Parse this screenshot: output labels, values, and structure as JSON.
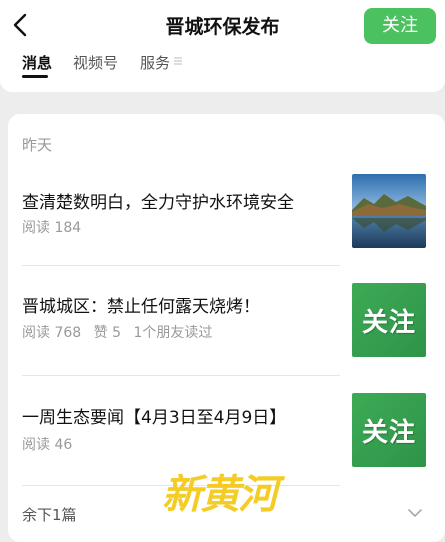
{
  "header": {
    "title": "晋城环保发布",
    "follow_label": "关注"
  },
  "tabs": [
    {
      "label": "消息",
      "active": true
    },
    {
      "label": "视频号",
      "active": false
    },
    {
      "label": "服务",
      "active": false
    }
  ],
  "feed": {
    "date_label": "昨天",
    "articles": [
      {
        "title": "查清楚数明白，全力守护水环境安全",
        "reads": "阅读 184",
        "likes": "",
        "friends": "",
        "thumb": "lake-photo"
      },
      {
        "title": "晋城城区：禁止任何露天烧烤！",
        "reads": "阅读 768",
        "likes": "赞 5",
        "friends": "1个朋友读过",
        "thumb_text": "关注"
      },
      {
        "title": "一周生态要闻【4月3日至4月9日】",
        "reads": "阅读 46",
        "likes": "",
        "friends": "",
        "thumb_text": "关注"
      }
    ],
    "remaining_label": "余下1篇"
  },
  "watermark": "新黄河",
  "colors": {
    "accent": "#4cc160",
    "thumb_green": "#3daa56",
    "watermark": "#f4c400"
  }
}
